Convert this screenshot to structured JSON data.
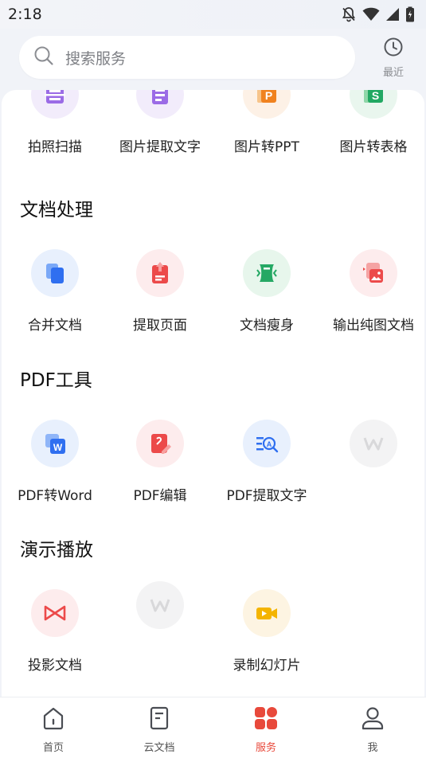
{
  "status_bar": {
    "time": "2:18"
  },
  "search": {
    "placeholder": "搜索服务"
  },
  "recent": {
    "label": "最近"
  },
  "top_row": [
    {
      "label": "拍照扫描",
      "icon": "scan-icon",
      "bg": "#f2ecfb"
    },
    {
      "label": "图片提取文字",
      "icon": "image-text-icon",
      "bg": "#f2ecfb"
    },
    {
      "label": "图片转PPT",
      "icon": "ppt-icon",
      "bg": "#fdf1e6"
    },
    {
      "label": "图片转表格",
      "icon": "sheet-icon",
      "bg": "#e9f6ee"
    }
  ],
  "sections": [
    {
      "title": "文档处理",
      "items": [
        {
          "label": "合并文档",
          "icon": "merge-doc-icon",
          "bg": "#e8f0fd"
        },
        {
          "label": "提取页面",
          "icon": "extract-page-icon",
          "bg": "#fdeced"
        },
        {
          "label": "文档瘦身",
          "icon": "slim-doc-icon",
          "bg": "#e7f6ec"
        },
        {
          "label": "输出纯图文档",
          "icon": "image-doc-icon",
          "bg": "#fdeced"
        }
      ]
    },
    {
      "title": "PDF工具",
      "items": [
        {
          "label": "PDF转Word",
          "icon": "pdf-to-word-icon",
          "bg": "#e8f0fd"
        },
        {
          "label": "PDF编辑",
          "icon": "pdf-edit-icon",
          "bg": "#fdeced"
        },
        {
          "label": "PDF提取文字",
          "icon": "pdf-text-icon",
          "bg": "#e8f0fd"
        },
        {
          "label": "",
          "icon": "wps-placeholder-icon",
          "bg": "#f3f3f4"
        }
      ]
    },
    {
      "title": "演示播放",
      "items": [
        {
          "label": "投影文档",
          "icon": "projection-icon",
          "bg": "#fdeced"
        },
        {
          "label": "",
          "icon": "wps-placeholder-icon",
          "bg": "#f3f3f4"
        },
        {
          "label": "录制幻灯片",
          "icon": "record-slide-icon",
          "bg": "#fdf4e2"
        }
      ]
    }
  ],
  "bottom_nav": [
    {
      "label": "首页",
      "icon": "home-icon",
      "active": false
    },
    {
      "label": "云文档",
      "icon": "cloud-doc-icon",
      "active": false
    },
    {
      "label": "服务",
      "icon": "services-grid-icon",
      "active": true
    },
    {
      "label": "我",
      "icon": "profile-icon",
      "active": false
    }
  ],
  "colors": {
    "accent": "#e8493b",
    "background": "#f1f3f8"
  }
}
